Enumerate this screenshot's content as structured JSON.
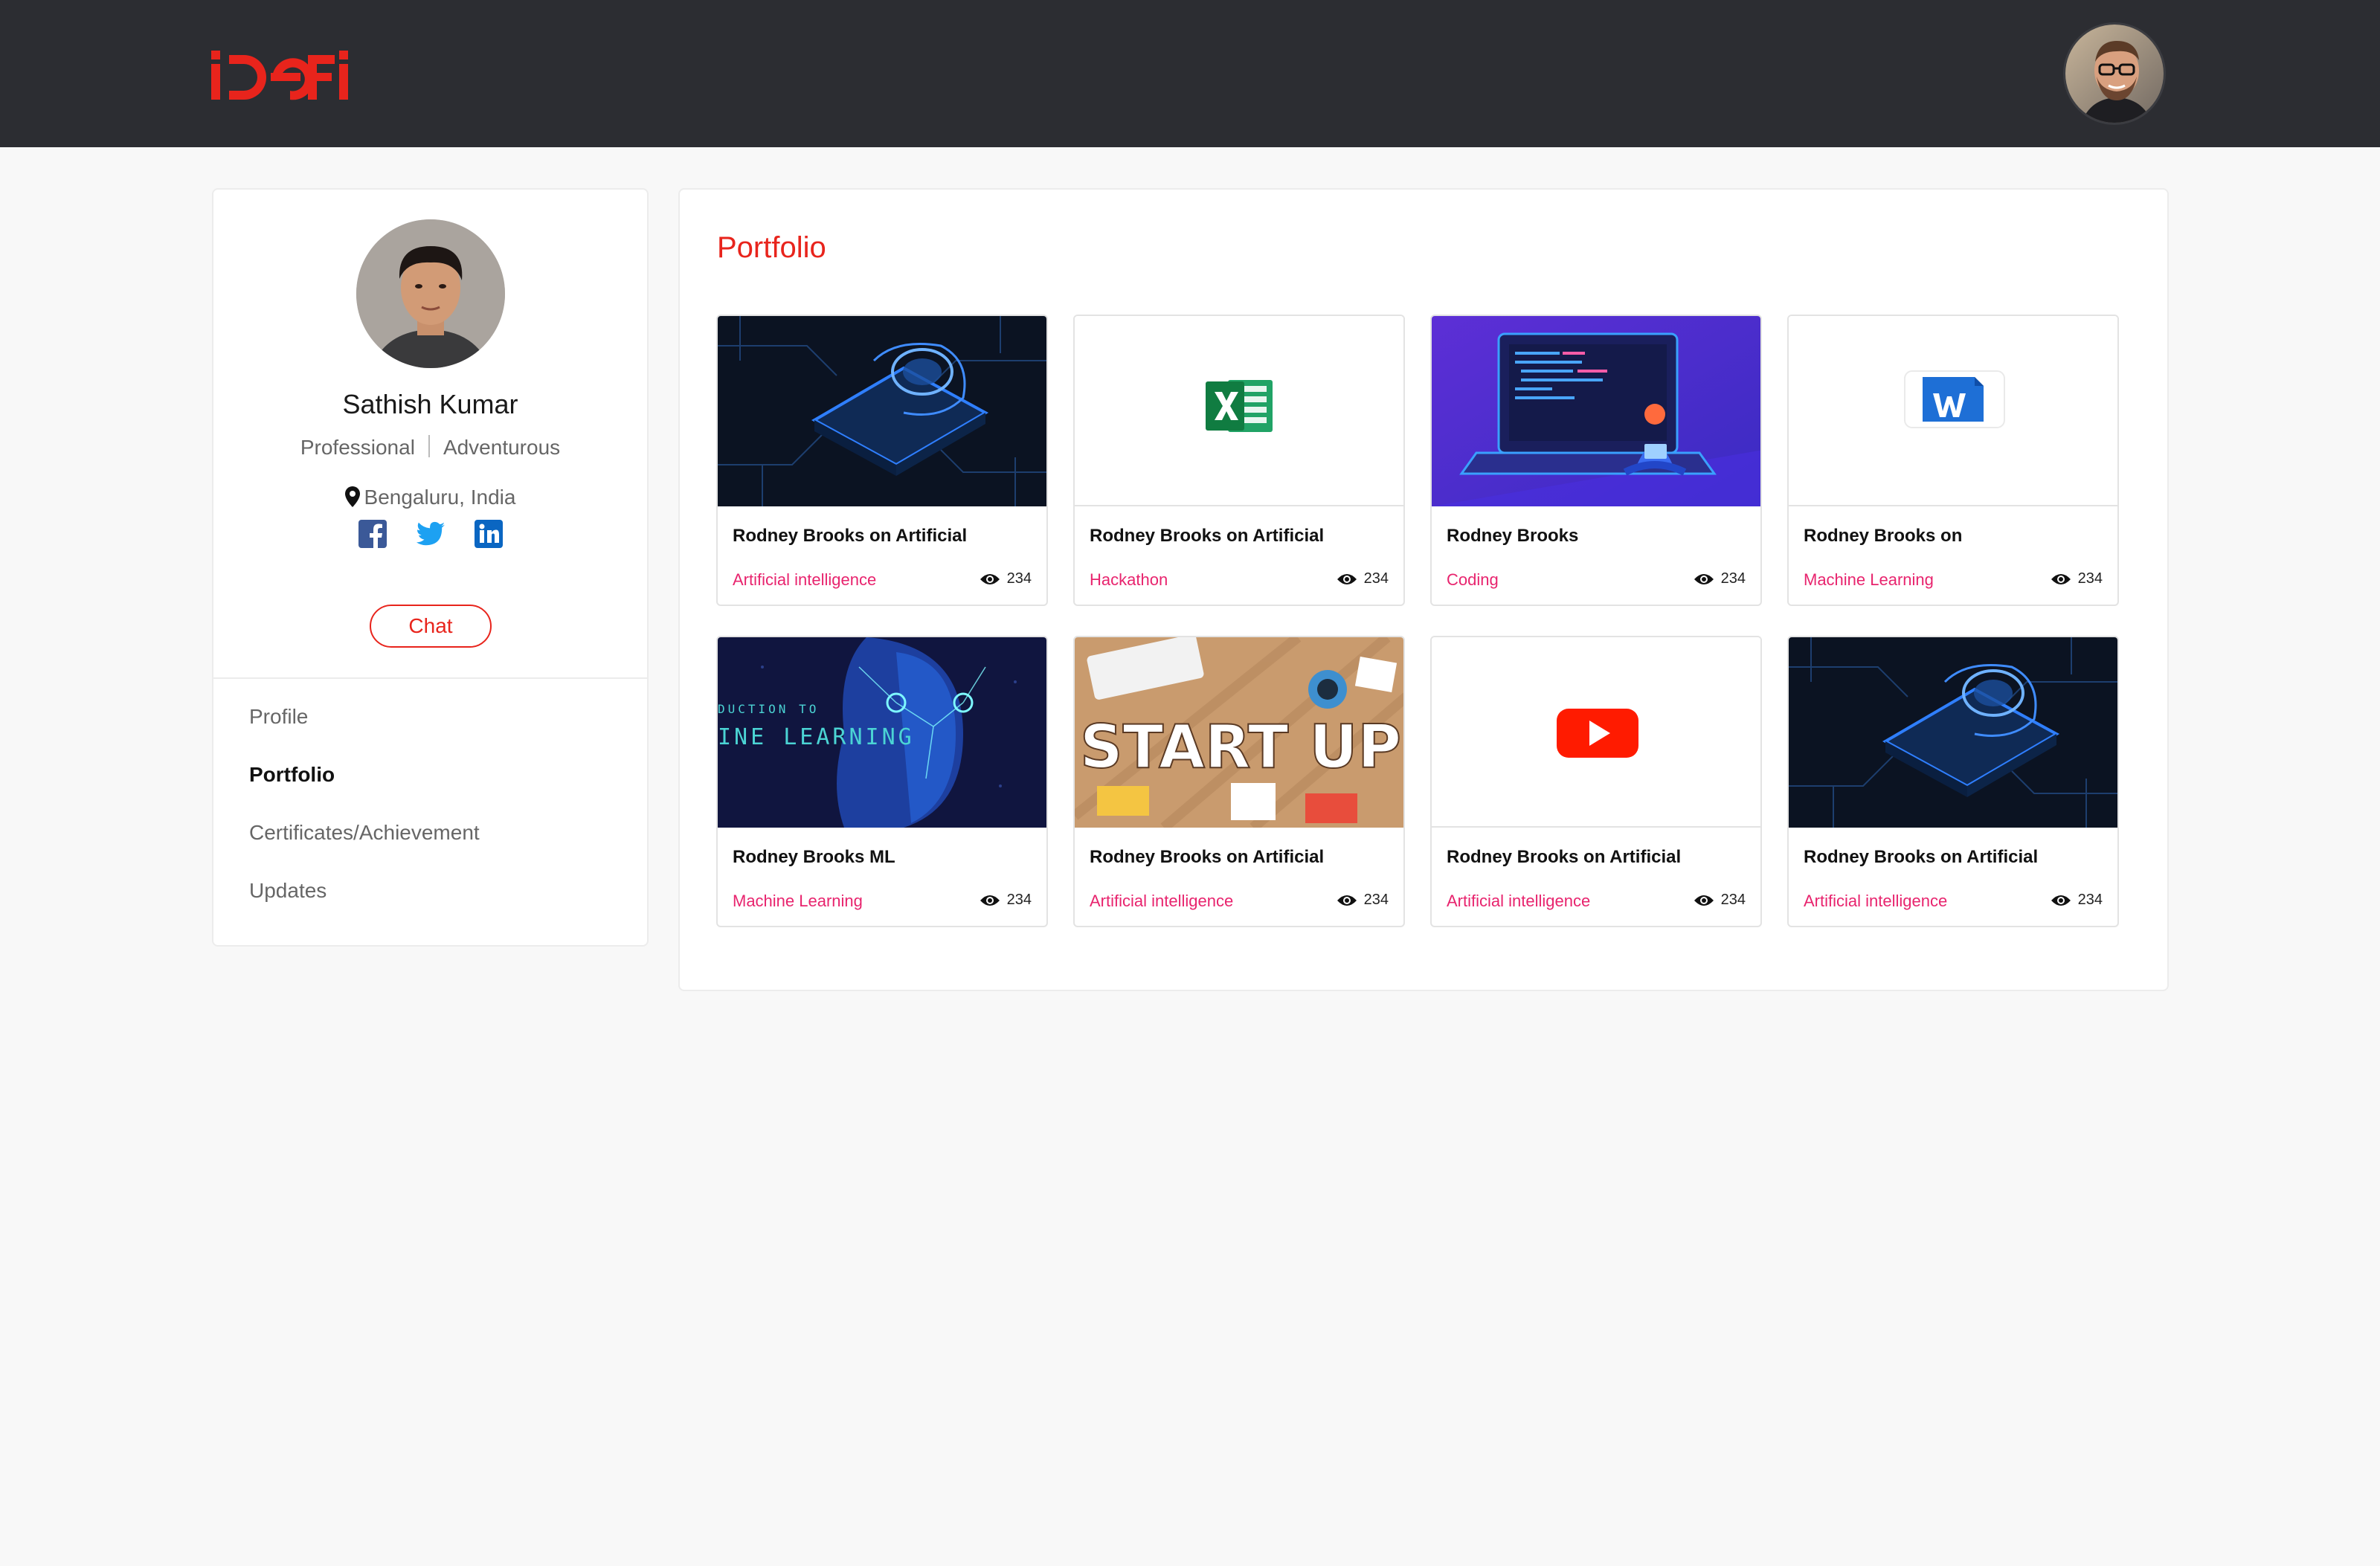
{
  "header": {
    "logo_text": "iDEFi",
    "brand_color": "#e8241c"
  },
  "profile": {
    "name": "Sathish Kumar",
    "tag_1": "Professional",
    "tag_2": "Adventurous",
    "location": "Bengaluru, India",
    "chat_label": "Chat",
    "social_icons": [
      "facebook-icon",
      "twitter-icon",
      "linkedin-icon"
    ]
  },
  "side_nav": {
    "items": [
      {
        "label": "Profile",
        "active": false
      },
      {
        "label": "Portfolio",
        "active": true
      },
      {
        "label": "Certificates/Achievement",
        "active": false
      },
      {
        "label": "Updates",
        "active": false
      }
    ]
  },
  "portfolio": {
    "title": "Portfolio",
    "items": [
      {
        "title": "Rodney Brooks on Artificial",
        "category": "Artificial intelligence",
        "views": "234",
        "thumb": "ai-chip"
      },
      {
        "title": "Rodney Brooks on Artificial",
        "category": "Hackathon",
        "views": "234",
        "thumb": "excel-icon"
      },
      {
        "title": "Rodney Brooks",
        "category": "Coding",
        "views": "234",
        "thumb": "coding"
      },
      {
        "title": "Rodney Brooks on",
        "category": "Machine Learning",
        "views": "234",
        "thumb": "word-icon"
      },
      {
        "title": "Rodney Brooks ML",
        "category": "Machine Learning",
        "views": "234",
        "thumb": "ml-face",
        "thumb_text": "INE LEARNING",
        "thumb_small": "DUCTION TO"
      },
      {
        "title": "Rodney Brooks on Artificial",
        "category": "Artificial intelligence",
        "views": "234",
        "thumb": "startup",
        "thumb_text": "START UP"
      },
      {
        "title": "Rodney Brooks on Artificial",
        "category": "Artificial intelligence",
        "views": "234",
        "thumb": "youtube-icon"
      },
      {
        "title": "Rodney Brooks on Artificial",
        "category": "Artificial intelligence",
        "views": "234",
        "thumb": "ai-chip"
      }
    ]
  },
  "colors": {
    "accent": "#e8241c",
    "category": "#e8246e",
    "header_bg": "#2c2d32",
    "page_bg": "#f8f8f8"
  }
}
